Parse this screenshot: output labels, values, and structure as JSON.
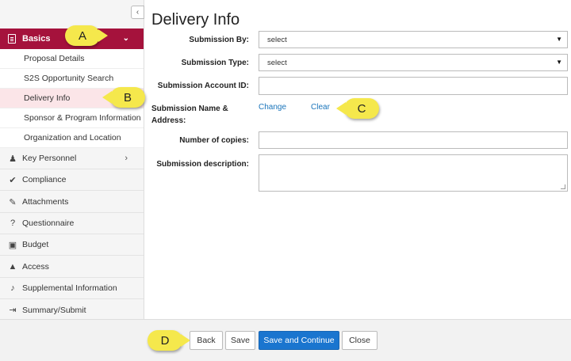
{
  "sidebar": {
    "collapse_icon": "chevron-left",
    "basics": {
      "label": "Basics",
      "icon": "document-icon",
      "chevron": "chevron-down"
    },
    "sub_items": [
      {
        "label": "Proposal Details"
      },
      {
        "label": "S2S Opportunity Search"
      },
      {
        "label": "Delivery Info"
      },
      {
        "label": "Sponsor & Program Information"
      },
      {
        "label": "Organization and Location"
      }
    ],
    "items": [
      {
        "label": "Key Personnel",
        "icon": "person-icon"
      },
      {
        "label": "Compliance",
        "icon": "check-icon"
      },
      {
        "label": "Attachments",
        "icon": "paperclip-icon"
      },
      {
        "label": "Questionnaire",
        "icon": "question-icon"
      },
      {
        "label": "Budget",
        "icon": "money-icon"
      },
      {
        "label": "Access",
        "icon": "lock-icon"
      },
      {
        "label": "Supplemental Information",
        "icon": "bell-icon"
      },
      {
        "label": "Summary/Submit",
        "icon": "sign-out-icon"
      }
    ]
  },
  "main": {
    "title": "Delivery Info",
    "submission_by": {
      "label": "Submission By:",
      "value": "select"
    },
    "submission_type": {
      "label": "Submission Type:",
      "value": "select"
    },
    "submission_account": {
      "label": "Submission Account ID:",
      "value": ""
    },
    "submission_name": {
      "label_line1": "Submission Name &",
      "label_line2": "Address:",
      "change": "Change",
      "clear": "Clear"
    },
    "copies": {
      "label": "Number of copies:",
      "value": ""
    },
    "description": {
      "label": "Submission description:",
      "value": ""
    }
  },
  "callouts": {
    "a": "A",
    "b": "B",
    "c": "C",
    "d": "D"
  },
  "footer": {
    "back": "Back",
    "save": "Save",
    "save_continue": "Save and Continue",
    "close": "Close"
  },
  "colors": {
    "accent": "#a5123c",
    "active_bg": "#fbe5e8",
    "primary": "#1a75cf",
    "link": "#1a75bb",
    "callout": "#f5e84c"
  }
}
